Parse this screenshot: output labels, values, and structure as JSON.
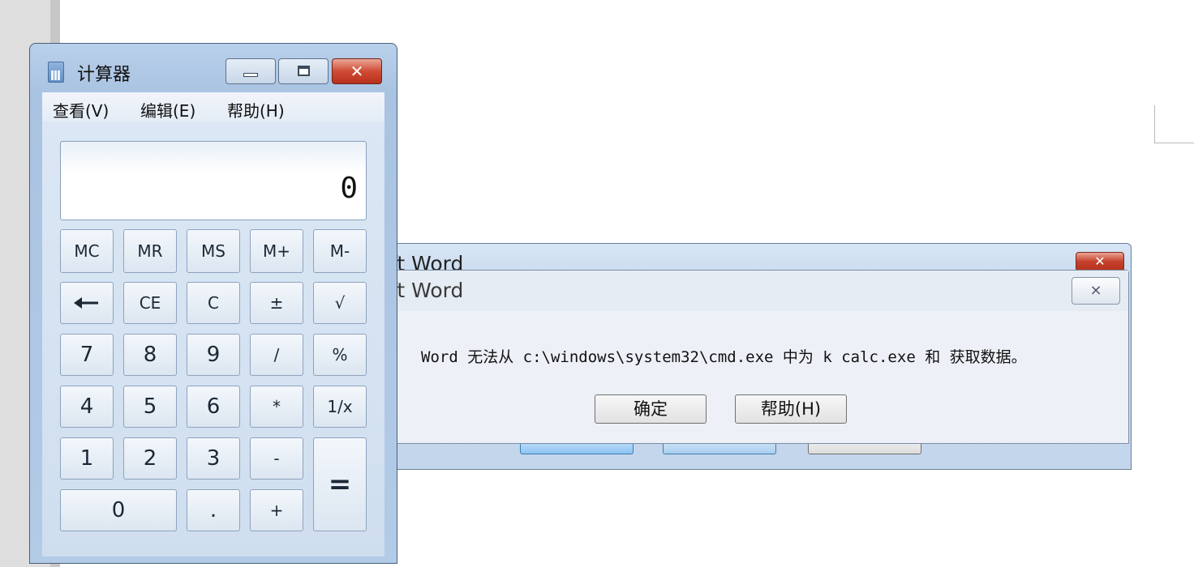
{
  "calculator": {
    "title": "计算器",
    "close_glyph": "✕",
    "menu": {
      "view": "查看(V)",
      "edit": "编辑(E)",
      "help": "帮助(H)"
    },
    "display": "0",
    "keys": {
      "mc": "MC",
      "mr": "MR",
      "ms": "MS",
      "m_plus": "M+",
      "m_minus": "M-",
      "backspace_icon": "arrow-left",
      "ce": "CE",
      "c": "C",
      "plus_minus": "±",
      "sqrt": "√",
      "seven": "7",
      "eight": "8",
      "nine": "9",
      "divide": "/",
      "percent": "%",
      "four": "4",
      "five": "5",
      "six": "6",
      "multiply": "*",
      "reciprocal": "1/x",
      "one": "1",
      "two": "2",
      "three": "3",
      "minus": "-",
      "equals": "=",
      "zero": "0",
      "decimal": ".",
      "plus": "+"
    }
  },
  "error_dialog": {
    "title": "ft Word",
    "close_glyph": "⨯",
    "message": "Word 无法从 c:\\windows\\system32\\cmd.exe 中为 k calc.exe 和  获取数据。",
    "ok_label": "确定",
    "help_label": "帮助(H)"
  },
  "background_dialog": {
    "title": "ft Word",
    "close_glyph": "✕"
  }
}
